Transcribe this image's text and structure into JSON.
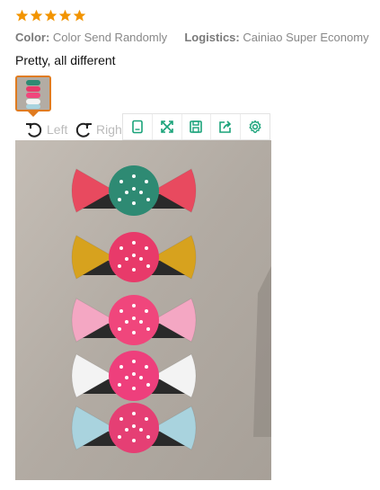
{
  "rating": {
    "stars": 5,
    "max": 5,
    "color": "#f29400"
  },
  "attributes": [
    {
      "label": "Color:",
      "value": "Color Send Randomly"
    },
    {
      "label": "Logistics:",
      "value": "Cainiao Super Economy"
    }
  ],
  "review_text": "Pretty, all different",
  "viewer": {
    "rotate_left_label": "Left",
    "rotate_right_label": "Right",
    "accent_color": "#1aa37a",
    "tools": [
      "fit-icon",
      "fullscreen-icon",
      "save-icon",
      "share-icon",
      "settings-icon"
    ]
  },
  "candies": [
    {
      "center": "#2e8a73",
      "wrapper": "#e84a5f"
    },
    {
      "center": "#e83a6a",
      "wrapper": "#d7a21e"
    },
    {
      "center": "#f0467c",
      "wrapper": "#f4a7c3"
    },
    {
      "center": "#ee3f7c",
      "wrapper": "#f3f3f3"
    },
    {
      "center": "#e53f74",
      "wrapper": "#a9d3de"
    }
  ]
}
